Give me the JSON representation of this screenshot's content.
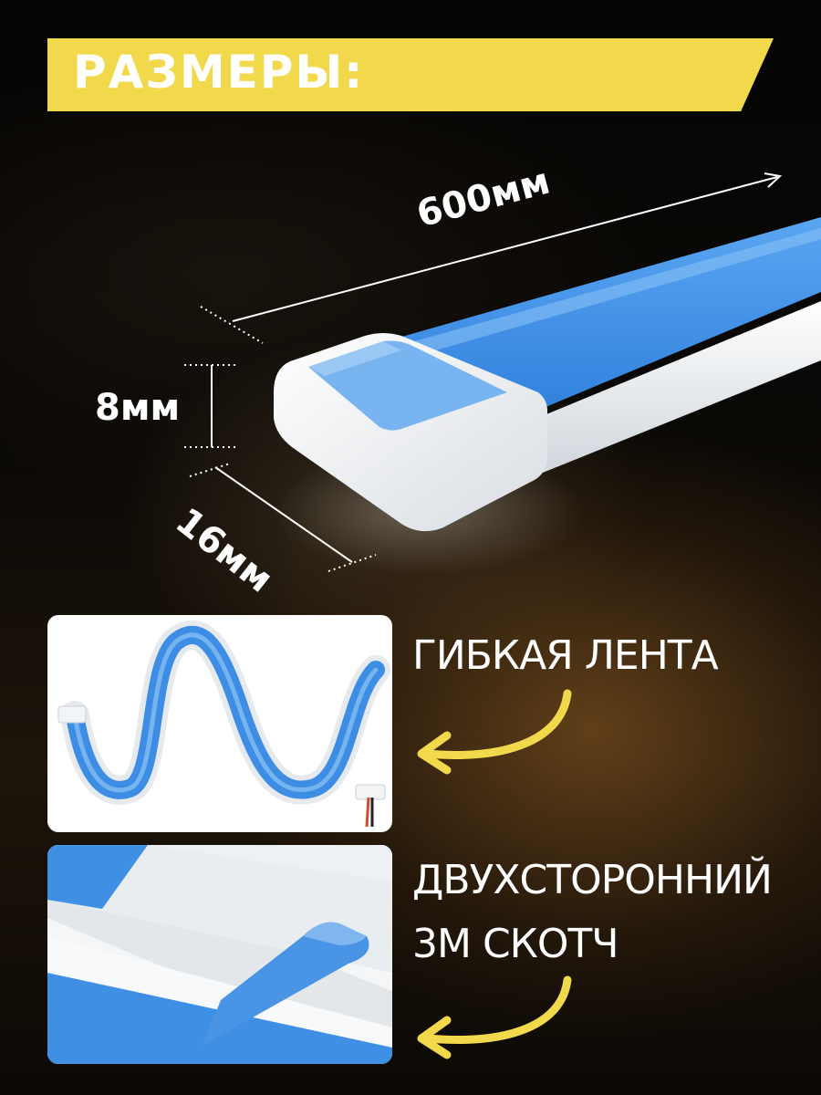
{
  "header": {
    "title": "РАЗМЕРЫ:"
  },
  "dimensions": {
    "length": "600мм",
    "height": "8мм",
    "width": "16мм"
  },
  "features": {
    "flexible": "ГИБКАЯ ЛЕНТА",
    "tape_line1": "ДВУХСТОРОННИЙ",
    "tape_line2": "3М СКОТЧ"
  },
  "colors": {
    "accent": "#f2d94b",
    "strip_blue": "#3f8fe6",
    "arrow": "#f2d94b"
  }
}
